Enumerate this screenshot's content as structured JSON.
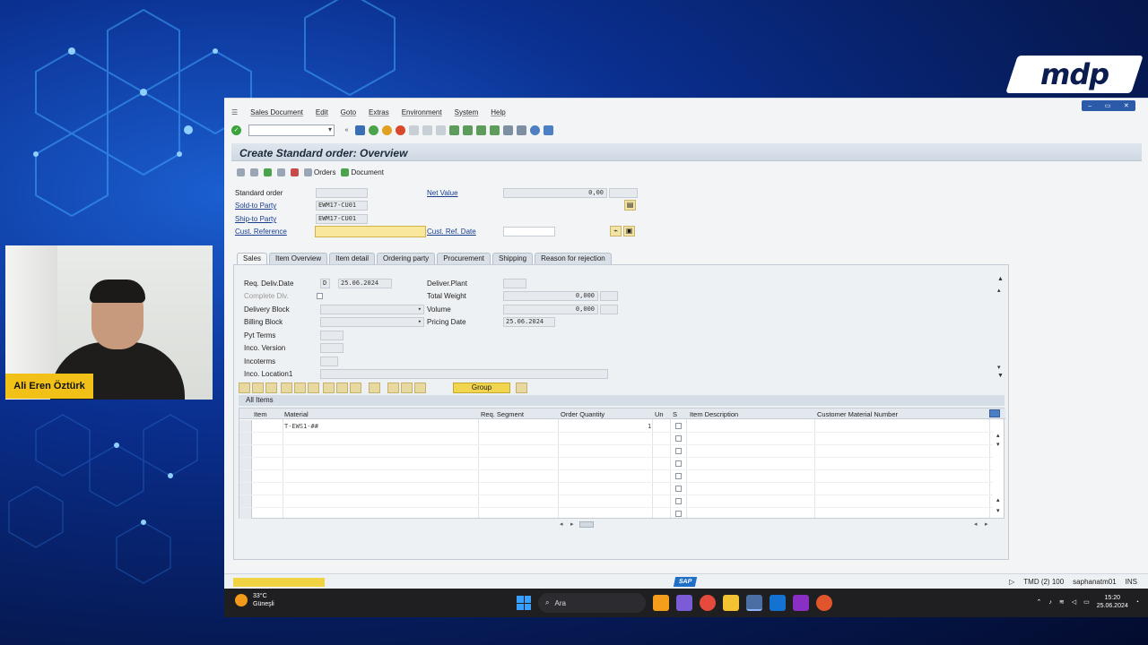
{
  "overlay": {
    "logo_text": "mdp",
    "presenter_name": "Ali Eren Öztürk"
  },
  "window_controls": [
    "–",
    "▭",
    "✕"
  ],
  "menu": [
    "Sales Document",
    "Edit",
    "Goto",
    "Extras",
    "Environment",
    "System",
    "Help"
  ],
  "screen": {
    "title": "Create Standard order: Overview",
    "app_toolbar": {
      "orders": "Orders",
      "document": "Document"
    }
  },
  "header": {
    "standard_order_label": "Standard order",
    "standard_order_value": "",
    "net_value_label": "Net Value",
    "net_value": "0,00",
    "sold_to_label": "Sold-to Party",
    "sold_to_value": "EWM17-CU01",
    "ship_to_label": "Ship-to Party",
    "ship_to_value": "EWM17-CU01",
    "cust_ref_label": "Cust. Reference",
    "cust_ref_value": "",
    "cust_ref_date_label": "Cust. Ref. Date",
    "cust_ref_date_value": ""
  },
  "tabs": [
    "Sales",
    "Item Overview",
    "Item detail",
    "Ordering party",
    "Procurement",
    "Shipping",
    "Reason for rejection"
  ],
  "sales_tab": {
    "req_deliv_date_label": "Req. Deliv.Date",
    "req_deliv_date_fmt": "D",
    "req_deliv_date_value": "25.06.2024",
    "complete_dlv_label": "Complete Dlv.",
    "delivery_block_label": "Delivery Block",
    "billing_block_label": "Billing Block",
    "pyt_terms_label": "Pyt Terms",
    "inco_version_label": "Inco. Version",
    "incoterms_label": "Incoterms",
    "inco_location_label": "Inco. Location1",
    "deliver_plant_label": "Deliver.Plant",
    "total_weight_label": "Total Weight",
    "total_weight_value": "0,000",
    "volume_label": "Volume",
    "volume_value": "0,000",
    "pricing_date_label": "Pricing Date",
    "pricing_date_value": "25.06.2024"
  },
  "items": {
    "group_button": "Group",
    "section_title": "All Items",
    "columns": [
      "Item",
      "Material",
      "Req. Segment",
      "Order Quantity",
      "Un",
      "S",
      "Item Description",
      "Customer Material Number"
    ],
    "rows": [
      {
        "item": "",
        "material": "T-EWS1-##",
        "req_segment": "",
        "qty": "1",
        "un": ""
      }
    ]
  },
  "status": {
    "system": "TMD (2) 100",
    "user": "saphanatm01",
    "mode": "INS"
  },
  "taskbar": {
    "temperature": "33°C",
    "weather": "Güneşli",
    "search": "Ara",
    "time": "15:20",
    "date": "25.06.2024"
  }
}
